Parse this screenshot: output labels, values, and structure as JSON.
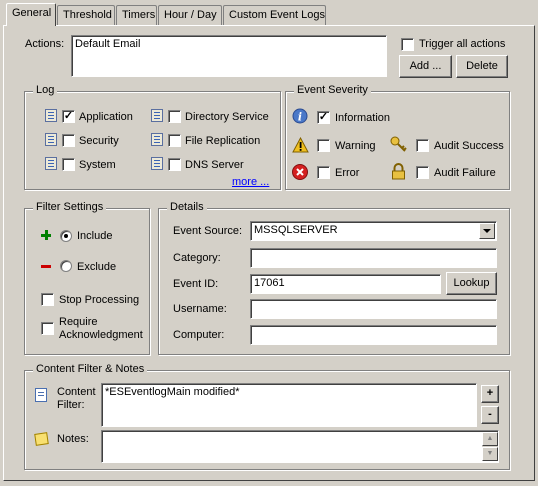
{
  "tabs": [
    "General",
    "Threshold",
    "Timers",
    "Hour / Day",
    "Custom Event Logs"
  ],
  "actions": {
    "label": "Actions:",
    "list_value": "Default Email",
    "trigger_all_label": "Trigger all actions",
    "add_label": "Add ...",
    "delete_label": "Delete"
  },
  "log": {
    "title": "Log",
    "items": [
      {
        "label": "Application",
        "checked": true
      },
      {
        "label": "Security",
        "checked": false
      },
      {
        "label": "System",
        "checked": false
      },
      {
        "label": "Directory Service",
        "checked": false
      },
      {
        "label": "File Replication",
        "checked": false
      },
      {
        "label": "DNS Server",
        "checked": false
      }
    ],
    "more_label": "more ..."
  },
  "severity": {
    "title": "Event Severity",
    "information": "Information",
    "warning": "Warning",
    "error": "Error",
    "audit_success": "Audit Success",
    "audit_failure": "Audit Failure"
  },
  "filter": {
    "title": "Filter Settings",
    "include": "Include",
    "exclude": "Exclude",
    "stop_processing": "Stop Processing",
    "require_ack": "Require Acknowledgment"
  },
  "details": {
    "title": "Details",
    "event_source_label": "Event Source:",
    "event_source_value": "MSSQLSERVER",
    "category_label": "Category:",
    "category_value": "",
    "event_id_label": "Event ID:",
    "event_id_value": "17061",
    "lookup_label": "Lookup",
    "username_label": "Username:",
    "username_value": "",
    "computer_label": "Computer:",
    "computer_value": ""
  },
  "content": {
    "title": "Content Filter & Notes",
    "content_filter_label": "Content Filter:",
    "content_filter_value": "*ESEventlogMain modified*",
    "notes_label": "Notes:",
    "notes_value": "",
    "plus_label": "+",
    "minus_label": "-"
  },
  "colors": {
    "dialog_bg": "#d4d0c8",
    "link": "#0000ff",
    "include_icon": "#008000",
    "exclude_icon": "#cc0000"
  }
}
